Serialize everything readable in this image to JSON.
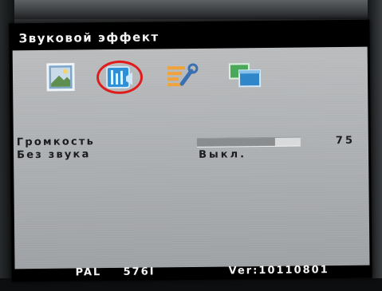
{
  "menu": {
    "title": "Звуковой эффект",
    "tabs": [
      {
        "icon": "picture-icon",
        "selected": false
      },
      {
        "icon": "audio-equalizer-icon",
        "selected": true
      },
      {
        "icon": "setup-tools-icon",
        "selected": false
      },
      {
        "icon": "display-windows-icon",
        "selected": false
      }
    ]
  },
  "settings": {
    "volume_label": "Громкость",
    "volume_value": "75",
    "volume_level": 0.75,
    "mute_label": "Без звука",
    "mute_value": "Выкл."
  },
  "footer": {
    "signal": "PAL",
    "resolution": "576I",
    "version": "Ver:10110801"
  },
  "colors": {
    "highlight_ring": "#e01b1b",
    "panel_background": "#b2b5b8"
  }
}
